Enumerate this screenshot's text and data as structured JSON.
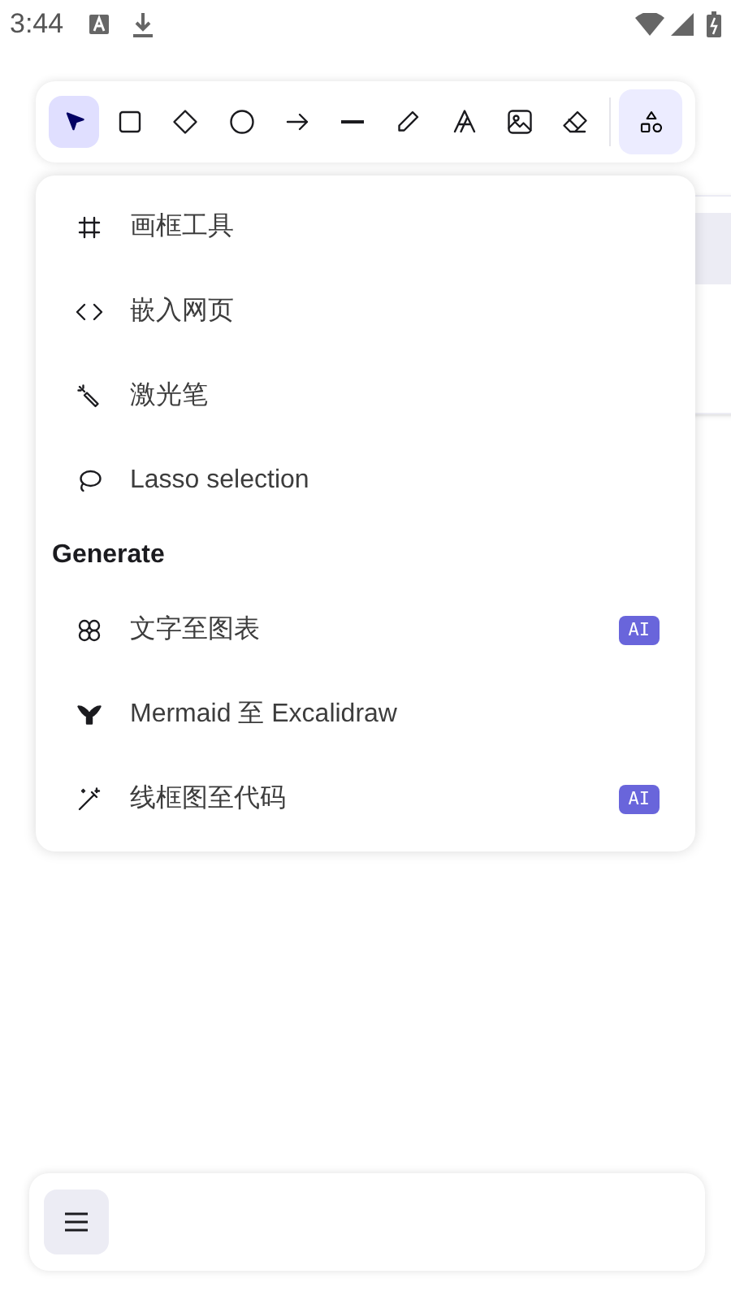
{
  "status_bar": {
    "time": "3:44"
  },
  "toolbar": {
    "tools": [
      {
        "kind": "selection",
        "selected": true
      },
      {
        "kind": "rectangle",
        "selected": false
      },
      {
        "kind": "diamond",
        "selected": false
      },
      {
        "kind": "ellipse",
        "selected": false
      },
      {
        "kind": "arrow",
        "selected": false
      },
      {
        "kind": "line",
        "selected": false
      },
      {
        "kind": "draw",
        "selected": false
      },
      {
        "kind": "text",
        "selected": false
      },
      {
        "kind": "image",
        "selected": false
      },
      {
        "kind": "eraser",
        "selected": false
      }
    ],
    "more_tools": {
      "selected": true
    }
  },
  "menu": {
    "items": [
      {
        "kind": "frame",
        "label": "画框工具"
      },
      {
        "kind": "embed",
        "label": "嵌入网页"
      },
      {
        "kind": "laser",
        "label": "激光笔"
      },
      {
        "kind": "lasso",
        "label": "Lasso selection"
      }
    ],
    "section_title": "Generate",
    "generate_items": [
      {
        "kind": "brain",
        "label": "文字至图表",
        "badge": "AI"
      },
      {
        "kind": "mermaid",
        "label": "Mermaid 至 Excalidraw"
      },
      {
        "kind": "wand",
        "label": "线框图至代码",
        "badge": "AI"
      }
    ]
  }
}
